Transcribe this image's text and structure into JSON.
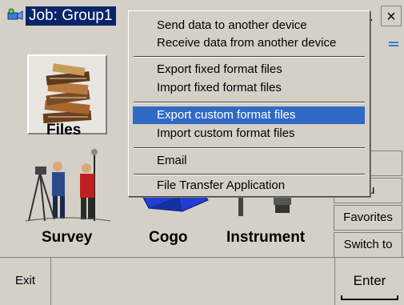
{
  "window": {
    "title": "Job: Group1",
    "close_label": "×",
    "partial_button": "."
  },
  "main": {
    "tiles": [
      {
        "label": "Files",
        "icon": "files-icon"
      },
      {
        "label": "Survey",
        "icon": "survey-icon"
      },
      {
        "label": "Cogo",
        "icon": "cogo-icon"
      },
      {
        "label": "Instrument",
        "icon": "instrument-icon"
      }
    ]
  },
  "side_buttons": [
    {
      "label": "p"
    },
    {
      "label": "nu"
    },
    {
      "label": "Favorites"
    },
    {
      "label": "Switch to"
    }
  ],
  "bottom": {
    "exit_label": "Exit",
    "enter_label": "Enter"
  },
  "menu": {
    "items": [
      {
        "label": "Send data to another device",
        "selected": false
      },
      {
        "label": "Receive data from another device",
        "selected": false
      },
      {
        "label": "Export fixed format files",
        "selected": false
      },
      {
        "label": "Import fixed format files",
        "selected": false
      },
      {
        "label": "Export custom format files",
        "selected": true
      },
      {
        "label": "Import custom format files",
        "selected": false
      },
      {
        "label": "Email",
        "selected": false
      },
      {
        "label": "File Transfer Application",
        "selected": false
      }
    ]
  },
  "colors": {
    "selection": "#316ac5",
    "title_highlight": "#0a246a",
    "face": "#d4d0c8"
  }
}
